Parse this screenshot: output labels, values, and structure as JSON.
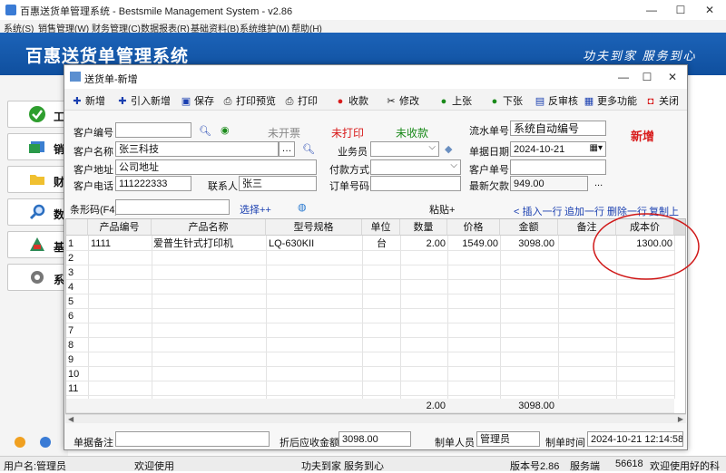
{
  "window": {
    "title": "百惠送货单管理系统 - Bestsmile Management System - v2.86",
    "menus": [
      "系统(S)",
      "销售管理(W)",
      "财务管理(C)",
      "数据报表(R)",
      "基础资料(B)",
      "系统维护(M)",
      "帮助(H)"
    ],
    "banner_title": "百惠送货单管理系统",
    "banner_slogan": "功夫到家 服务到心"
  },
  "sidebar": {
    "items": [
      {
        "label": "工",
        "icon": "check-icon"
      },
      {
        "label": "销",
        "icon": "window-icon"
      },
      {
        "label": "财",
        "icon": "folder-icon"
      },
      {
        "label": "数",
        "icon": "search-icon"
      },
      {
        "label": "基",
        "icon": "tree-icon"
      },
      {
        "label": "系",
        "icon": "gear-icon"
      }
    ]
  },
  "dialog": {
    "title": "送货单-新增",
    "toolbar": [
      "新增",
      "引入新增",
      "保存",
      "打印预览",
      "打印",
      "收款",
      "修改",
      "上张",
      "下张",
      "反审核",
      "更多功能",
      "关闭"
    ],
    "form": {
      "customer_code_label": "客户编号",
      "customer_code": "",
      "status_invoice": "未开票",
      "status_print": "未打印",
      "status_payment": "未收款",
      "serial_label": "流水单号",
      "serial_value": "系统自动编号",
      "mode_badge": "新增",
      "customer_name_label": "客户名称",
      "customer_name": "张三科技",
      "salesman_label": "业务员",
      "salesman": "",
      "date_label": "单据日期",
      "date_value": "2024-10-21",
      "address_label": "客户地址",
      "address": "公司地址",
      "payment_label": "付款方式",
      "payment": "",
      "customer_order_label": "客户单号",
      "customer_order": "",
      "phone_label": "客户电话",
      "phone": "111222333",
      "contact_label": "联系人",
      "contact": "张三",
      "order_label": "订单号码",
      "order_no": "",
      "balance_label": "最新欠款",
      "balance": "949.00",
      "barcode_label": "条形码(F4)",
      "barcode": "",
      "select_link": "选择++",
      "paste_label": "粘贴+",
      "row_actions": [
        "< 插入一行",
        "追加一行",
        "删除一行",
        "复制上行"
      ]
    },
    "grid": {
      "headers": [
        "产品编号",
        "产品名称",
        "型号规格",
        "单位",
        "数量",
        "价格",
        "金额",
        "备注",
        "成本价"
      ],
      "rows": [
        {
          "no": "1",
          "code": "1111",
          "name": "爱普生针式打印机",
          "model": "LQ-630KII",
          "unit": "台",
          "qty": "2.00",
          "price": "1549.00",
          "amount": "3098.00",
          "note": "",
          "cost": "1300.00"
        },
        {
          "no": "2"
        },
        {
          "no": "3"
        },
        {
          "no": "4"
        },
        {
          "no": "5"
        },
        {
          "no": "6"
        },
        {
          "no": "7"
        },
        {
          "no": "8"
        },
        {
          "no": "9"
        },
        {
          "no": "10"
        },
        {
          "no": "11"
        }
      ],
      "total_qty": "2.00",
      "total_amount": "3098.00"
    },
    "footer": {
      "remark_label": "单据备注",
      "remark": "",
      "receivable_label": "折后应收金额",
      "receivable": "3098.00",
      "maker_label": "制单人员",
      "maker": "管理员",
      "time_label": "制单时间",
      "time": "2024-10-21 12:14:58"
    }
  },
  "status": {
    "user": "用户名:管理员",
    "welcome": "欢迎使用",
    "slogan": "功夫到家 服务到心",
    "version": "版本号2.86",
    "server": "服务端",
    "port": "56618",
    "greeting": "欢迎使用好的科"
  },
  "colors": {
    "banner": "#1563b8",
    "annotation": "#d01818",
    "status_red": "#d81c1c",
    "status_green": "#1a8a1a"
  }
}
